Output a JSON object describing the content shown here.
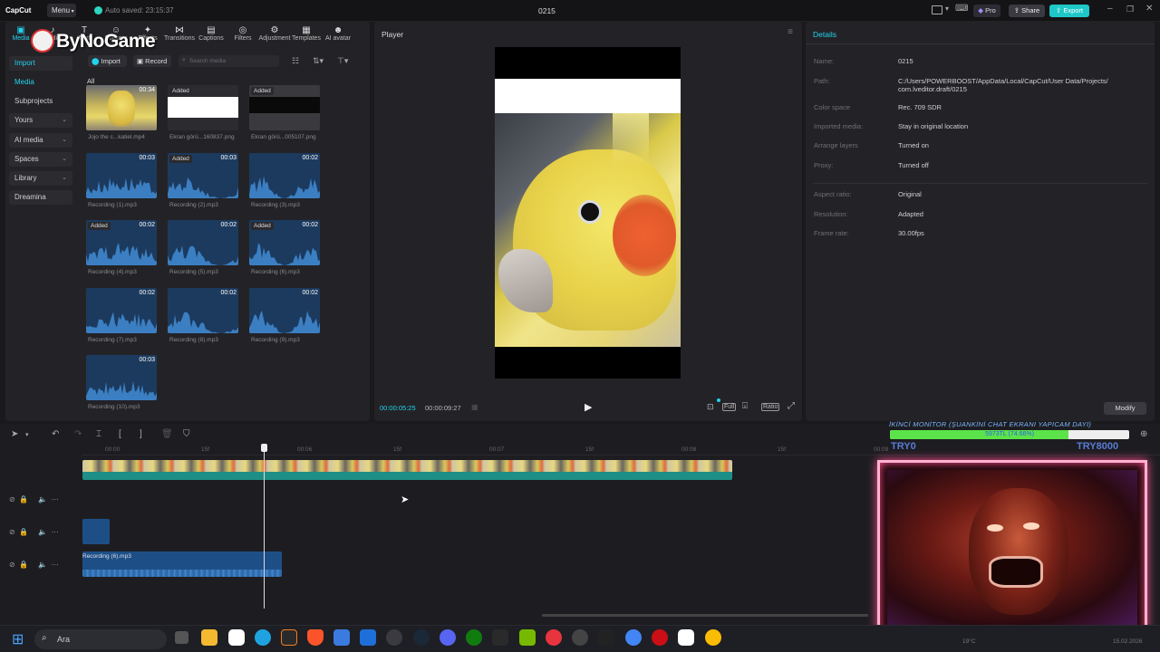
{
  "titlebar": {
    "app_name": "CapCut",
    "menu_label": "Menu",
    "autosave": "Auto saved: 23:15:37",
    "project_title": "0215",
    "pro_label": "Pro",
    "share_label": "Share",
    "export_label": "Export"
  },
  "watermark": "ByNoGame",
  "toolbar": [
    {
      "label": "Media",
      "icon": "media-icon"
    },
    {
      "label": "Audio",
      "icon": "audio-icon"
    },
    {
      "label": "Text",
      "icon": "text-icon"
    },
    {
      "label": "Stickers",
      "icon": "stickers-icon"
    },
    {
      "label": "Effects",
      "icon": "effects-icon"
    },
    {
      "label": "Transitions",
      "icon": "transitions-icon"
    },
    {
      "label": "Captions",
      "icon": "captions-icon"
    },
    {
      "label": "Filters",
      "icon": "filters-icon"
    },
    {
      "label": "Adjustment",
      "icon": "adjustment-icon"
    },
    {
      "label": "Templates",
      "icon": "templates-icon"
    },
    {
      "label": "AI avatar",
      "icon": "ai-avatar-icon"
    }
  ],
  "sidebar": {
    "items": [
      {
        "label": "Import",
        "chevron": false
      },
      {
        "label": "Media",
        "chevron": false
      },
      {
        "label": "Subprojects",
        "chevron": false
      },
      {
        "label": "Yours",
        "chevron": true
      },
      {
        "label": "AI media",
        "chevron": true
      },
      {
        "label": "Spaces",
        "chevron": true
      },
      {
        "label": "Library",
        "chevron": true
      },
      {
        "label": "Dreamina",
        "chevron": false
      }
    ]
  },
  "media": {
    "import_label": "Import",
    "record_label": "Record",
    "search_placeholder": "Search media",
    "filter_all": "All",
    "added_label": "Added",
    "items": [
      {
        "name": "Jojo the c...katiel.mp4",
        "duration": "00:34",
        "added": false,
        "kind": "video"
      },
      {
        "name": "Ekran görü...160837.png",
        "duration": "",
        "added": true,
        "kind": "white"
      },
      {
        "name": "Ekran görü...005107.png",
        "duration": "",
        "added": true,
        "kind": "dark"
      },
      {
        "name": "Recording (1).mp3",
        "duration": "00:03",
        "added": false,
        "kind": "audio"
      },
      {
        "name": "Recording (2).mp3",
        "duration": "00:03",
        "added": true,
        "kind": "audio"
      },
      {
        "name": "Recording (3).mp3",
        "duration": "00:02",
        "added": false,
        "kind": "audio"
      },
      {
        "name": "Recording (4).mp3",
        "duration": "00:02",
        "added": true,
        "kind": "audio"
      },
      {
        "name": "Recording (5).mp3",
        "duration": "00:02",
        "added": false,
        "kind": "audio"
      },
      {
        "name": "Recording (6).mp3",
        "duration": "00:02",
        "added": true,
        "kind": "audio"
      },
      {
        "name": "Recording (7).mp3",
        "duration": "00:02",
        "added": false,
        "kind": "audio"
      },
      {
        "name": "Recording (8).mp3",
        "duration": "00:02",
        "added": false,
        "kind": "audio"
      },
      {
        "name": "Recording (9).mp3",
        "duration": "00:02",
        "added": false,
        "kind": "audio"
      },
      {
        "name": "Recording (10).mp3",
        "duration": "00:03",
        "added": false,
        "kind": "audio"
      }
    ]
  },
  "player": {
    "title": "Player",
    "current_time": "00:00:05:25",
    "total_time": "00:00:09:27",
    "full_label": "Full",
    "ratio_label": "Ratio"
  },
  "details": {
    "title": "Details",
    "rows": [
      {
        "label": "Name:",
        "value": "0215"
      },
      {
        "label": "Path:",
        "value": "C:/Users/POWERBOOST/AppData/Local/CapCut/User Data/Projects/",
        "value2": "com.lveditor.draft/0215"
      },
      {
        "label": "Color space",
        "value": "Rec. 709 SDR"
      },
      {
        "label": "Imported media:",
        "value": "Stay in original location"
      },
      {
        "label": "Arrange layers",
        "value": "Turned on"
      },
      {
        "label": "Proxy:",
        "value": "Turned off"
      },
      {
        "label": "Aspect ratio:",
        "value": "Original"
      },
      {
        "label": "Resolution:",
        "value": "Adapted"
      },
      {
        "label": "Frame rate:",
        "value": "30.00fps"
      }
    ],
    "modify_label": "Modify"
  },
  "timeline": {
    "ruler": [
      "00:00",
      "15f",
      "00:06",
      "15f",
      "00:07",
      "15f",
      "00:08",
      "15f",
      "00:09"
    ],
    "audio_clip_label": "Recording (6).mp3"
  },
  "overlay": {
    "monitor_text": "İKİNCİ MONİTOR (ŞUANKİNİ CHAT EKRANI YAPICAM DAYI)",
    "progress_text": "5973TL (74.66%)",
    "progress_fraction": 0.7466,
    "left_label": "TRY0",
    "right_label": "TRY8000"
  },
  "taskbar": {
    "search_label": "Ara",
    "temperature": "19°C",
    "date": "15.02.2026"
  },
  "colors": {
    "accent": "#22d3ee",
    "export_bg": "#1fc8c8",
    "audio_clip": "#1d4f86",
    "video_track": "#1e8f86",
    "overlay_border": "#ff4d8d",
    "progress_fill": "#5ce34a"
  }
}
